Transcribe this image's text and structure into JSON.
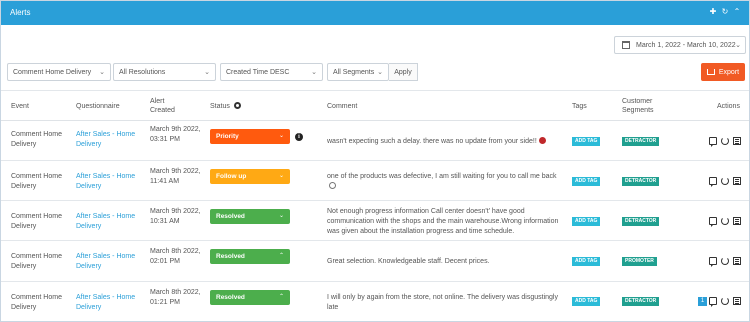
{
  "window": {
    "title": "Alerts"
  },
  "colors": {
    "titlebar": "#2a9fd8",
    "export": "#f15a24",
    "priority": "#ff5a0e",
    "followup": "#ffa914",
    "resolved": "#4cae4c",
    "tag": "#2bbbd8",
    "segment": "#20a090",
    "link": "#2a9fd8"
  },
  "date_range": {
    "label": "March 1, 2022  -  March 10, 2022",
    "icon": "calendar-icon"
  },
  "filters": {
    "event": "Comment Home Delivery",
    "resolution": "All Resolutions",
    "sort": "Created Time DESC",
    "segments": "All Segments",
    "apply": "Apply"
  },
  "export_label": "Export",
  "columns": {
    "event": "Event",
    "questionnaire": "Questionnaire",
    "alert_created": "Alert Created",
    "status": "Status",
    "comment": "Comment",
    "tags": "Tags",
    "segments": "Customer Segments",
    "actions": "Actions"
  },
  "rows": [
    {
      "event": "Comment Home Delivery",
      "questionnaire": "After Sales - Home Delivery",
      "created": "March 9th 2022, 03:31 PM",
      "status": "Priority",
      "comment": "wasn't expecting such a delay. there was no update from your side!!",
      "tag": "ADD TAG",
      "segment": "DETRACTOR"
    },
    {
      "event": "Comment Home Delivery",
      "questionnaire": "After Sales - Home Delivery",
      "created": "March 9th 2022, 11:41 AM",
      "status": "Follow up",
      "comment": "one of the products was defective, I am still waiting for you to call me back",
      "tag": "ADD TAG",
      "segment": "DETRACTOR"
    },
    {
      "event": "Comment Home Delivery",
      "questionnaire": "After Sales - Home Delivery",
      "created": "March 9th 2022, 10:31 AM",
      "status": "Resolved",
      "comment": "Not enough progress information Call center doesn't' have good communication with the shops and the main warehouse.Wrong information was given about the installation progress and time schedule.",
      "tag": "ADD TAG",
      "segment": "DETRACTOR"
    },
    {
      "event": "Comment Home Delivery",
      "questionnaire": "After Sales - Home Delivery",
      "created": "March 8th 2022, 02:01 PM",
      "status": "Resolved",
      "comment": "Great selection. Knowledgeable staff. Decent prices.",
      "tag": "ADD TAG",
      "segment": "PROMOTER"
    },
    {
      "event": "Comment Home Delivery",
      "questionnaire": "After Sales - Home Delivery",
      "created": "March 8th 2022, 01:21 PM",
      "status": "Resolved",
      "comment": "I will only by again from the store, not online. The delivery was disgustingly late",
      "tag": "ADD TAG",
      "segment": "DETRACTOR",
      "badge": "1"
    }
  ]
}
